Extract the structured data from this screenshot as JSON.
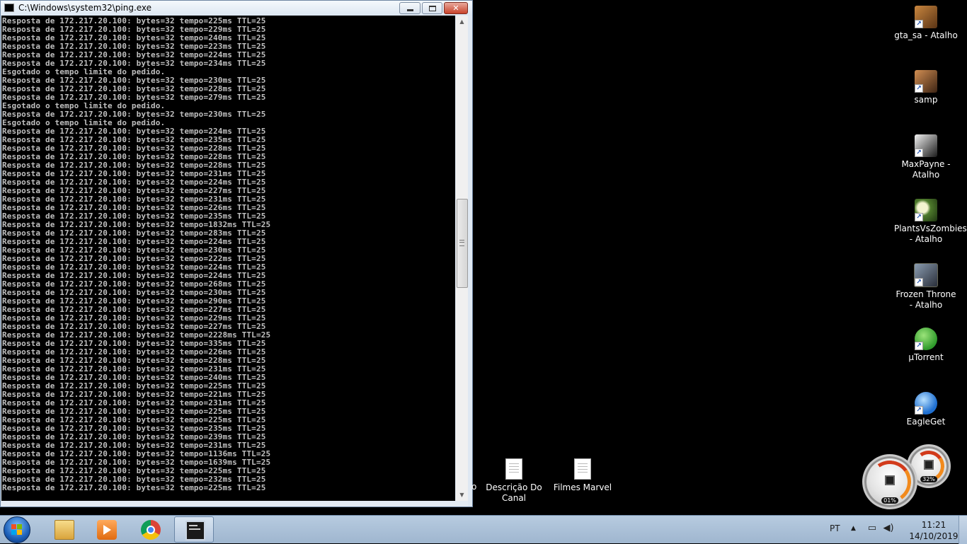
{
  "window": {
    "title": "C:\\Windows\\system32\\ping.exe",
    "buttons": {
      "minimize": "minimize",
      "maximize": "maximize",
      "close": "✕"
    }
  },
  "console": {
    "lines": [
      "Resposta de 172.217.20.100: bytes=32 tempo=225ms TTL=25",
      "Resposta de 172.217.20.100: bytes=32 tempo=229ms TTL=25",
      "Resposta de 172.217.20.100: bytes=32 tempo=240ms TTL=25",
      "Resposta de 172.217.20.100: bytes=32 tempo=223ms TTL=25",
      "Resposta de 172.217.20.100: bytes=32 tempo=224ms TTL=25",
      "Resposta de 172.217.20.100: bytes=32 tempo=234ms TTL=25",
      "Esgotado o tempo limite do pedido.",
      "Resposta de 172.217.20.100: bytes=32 tempo=230ms TTL=25",
      "Resposta de 172.217.20.100: bytes=32 tempo=228ms TTL=25",
      "Resposta de 172.217.20.100: bytes=32 tempo=279ms TTL=25",
      "Esgotado o tempo limite do pedido.",
      "Resposta de 172.217.20.100: bytes=32 tempo=230ms TTL=25",
      "Esgotado o tempo limite do pedido.",
      "Resposta de 172.217.20.100: bytes=32 tempo=224ms TTL=25",
      "Resposta de 172.217.20.100: bytes=32 tempo=235ms TTL=25",
      "Resposta de 172.217.20.100: bytes=32 tempo=228ms TTL=25",
      "Resposta de 172.217.20.100: bytes=32 tempo=228ms TTL=25",
      "Resposta de 172.217.20.100: bytes=32 tempo=228ms TTL=25",
      "Resposta de 172.217.20.100: bytes=32 tempo=231ms TTL=25",
      "Resposta de 172.217.20.100: bytes=32 tempo=224ms TTL=25",
      "Resposta de 172.217.20.100: bytes=32 tempo=227ms TTL=25",
      "Resposta de 172.217.20.100: bytes=32 tempo=231ms TTL=25",
      "Resposta de 172.217.20.100: bytes=32 tempo=226ms TTL=25",
      "Resposta de 172.217.20.100: bytes=32 tempo=235ms TTL=25",
      "Resposta de 172.217.20.100: bytes=32 tempo=1832ms TTL=25",
      "Resposta de 172.217.20.100: bytes=32 tempo=283ms TTL=25",
      "Resposta de 172.217.20.100: bytes=32 tempo=224ms TTL=25",
      "Resposta de 172.217.20.100: bytes=32 tempo=230ms TTL=25",
      "Resposta de 172.217.20.100: bytes=32 tempo=222ms TTL=25",
      "Resposta de 172.217.20.100: bytes=32 tempo=224ms TTL=25",
      "Resposta de 172.217.20.100: bytes=32 tempo=224ms TTL=25",
      "Resposta de 172.217.20.100: bytes=32 tempo=268ms TTL=25",
      "Resposta de 172.217.20.100: bytes=32 tempo=230ms TTL=25",
      "Resposta de 172.217.20.100: bytes=32 tempo=290ms TTL=25",
      "Resposta de 172.217.20.100: bytes=32 tempo=227ms TTL=25",
      "Resposta de 172.217.20.100: bytes=32 tempo=229ms TTL=25",
      "Resposta de 172.217.20.100: bytes=32 tempo=227ms TTL=25",
      "Resposta de 172.217.20.100: bytes=32 tempo=2228ms TTL=25",
      "Resposta de 172.217.20.100: bytes=32 tempo=335ms TTL=25",
      "Resposta de 172.217.20.100: bytes=32 tempo=226ms TTL=25",
      "Resposta de 172.217.20.100: bytes=32 tempo=228ms TTL=25",
      "Resposta de 172.217.20.100: bytes=32 tempo=231ms TTL=25",
      "Resposta de 172.217.20.100: bytes=32 tempo=240ms TTL=25",
      "Resposta de 172.217.20.100: bytes=32 tempo=225ms TTL=25",
      "Resposta de 172.217.20.100: bytes=32 tempo=221ms TTL=25",
      "Resposta de 172.217.20.100: bytes=32 tempo=231ms TTL=25",
      "Resposta de 172.217.20.100: bytes=32 tempo=225ms TTL=25",
      "Resposta de 172.217.20.100: bytes=32 tempo=225ms TTL=25",
      "Resposta de 172.217.20.100: bytes=32 tempo=235ms TTL=25",
      "Resposta de 172.217.20.100: bytes=32 tempo=239ms TTL=25",
      "Resposta de 172.217.20.100: bytes=32 tempo=231ms TTL=25",
      "Resposta de 172.217.20.100: bytes=32 tempo=1136ms TTL=25",
      "Resposta de 172.217.20.100: bytes=32 tempo=1639ms TTL=25",
      "Resposta de 172.217.20.100: bytes=32 tempo=225ms TTL=25",
      "Resposta de 172.217.20.100: bytes=32 tempo=232ms TTL=25",
      "Resposta de 172.217.20.100: bytes=32 tempo=225ms TTL=25"
    ]
  },
  "desktop": {
    "icons": [
      {
        "label": "gta_sa - Atalho",
        "icon": "gta-sa-icon"
      },
      {
        "label": "samp",
        "icon": "samp-icon"
      },
      {
        "label": "MaxPayne - Atalho",
        "icon": "maxpayne-icon"
      },
      {
        "label": "PlantsVsZombies - Atalho",
        "icon": "plantsvszombies-icon"
      },
      {
        "label": "Frozen Throne - Atalho",
        "icon": "frozen-throne-icon"
      },
      {
        "label": "µTorrent",
        "icon": "utorrent-icon"
      },
      {
        "label": "EagleGet",
        "icon": "eagleget-icon"
      }
    ],
    "files": [
      {
        "label": "Descrição Do Canal",
        "icon": "text-file-icon"
      },
      {
        "label": "Filmes Marvel",
        "icon": "text-file-icon"
      }
    ],
    "partial_label": "o"
  },
  "gadget": {
    "cpu_percent": "01%",
    "memory_percent": "32%"
  },
  "taskbar": {
    "language": "PT",
    "time": "11:21",
    "date": "14/10/2019",
    "pinned": [
      {
        "name": "windows-explorer",
        "icon": "folder-icon"
      },
      {
        "name": "media-player",
        "icon": "media-player-icon"
      },
      {
        "name": "google-chrome",
        "icon": "chrome-icon"
      },
      {
        "name": "command-prompt",
        "icon": "console-icon",
        "active": true
      }
    ]
  },
  "colors": {
    "console_bg": "#000000",
    "console_text": "#c0c0c0",
    "desktop_bg": "#000000",
    "taskbar": "#a9bfd8"
  }
}
